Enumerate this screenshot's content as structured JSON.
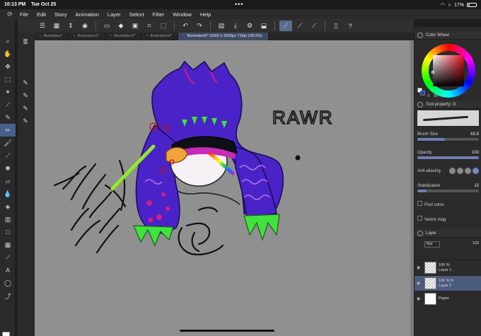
{
  "status_bar": {
    "time": "10:13 PM",
    "date": "Tue Oct 25",
    "battery": "17%"
  },
  "menu": [
    "File",
    "Edit",
    "Story",
    "Animation",
    "Layer",
    "Select",
    "Filter",
    "Window",
    "Help"
  ],
  "doc_tabs": [
    {
      "label": "Illustration*"
    },
    {
      "label": "Illustration2*"
    },
    {
      "label": "Illustration3*"
    },
    {
      "label": "Illustration4*"
    },
    {
      "label": "Illustration5* (3000 x 3200px 72dpi 106.5%)",
      "active": true
    }
  ],
  "canvas": {
    "text": "RAWR"
  },
  "color_wheel": {
    "title": "Color Wheel",
    "h": "0",
    "s": "90",
    "v": "13"
  },
  "tool_property": {
    "title": "Tool property: G",
    "brush_size_label": "Brush Size",
    "brush_size": "63.8",
    "opacity_label": "Opacity",
    "opacity": "100",
    "anti_aliasing_label": "Anti-aliasing",
    "stabilization_label": "Stabilization",
    "stabilization": "15",
    "post_correction_label": "Post corre",
    "vector_magnet_label": "Vector mag"
  },
  "layer_panel": {
    "title": "Layer",
    "blend_mode": "Nor",
    "opacity": "100",
    "layers": [
      {
        "name": "Layer 1",
        "info": "100 %"
      },
      {
        "name": "Layer 2",
        "info": "100 % N",
        "selected": true
      },
      {
        "name": "Paper",
        "info": ""
      }
    ]
  },
  "colors": {
    "active_tool": "#45608a",
    "canvas_bg": "#909090",
    "hat_purple": "#4a23c8",
    "tentacle_green": "#41e23d",
    "spots_magenta": "#d31c8a"
  }
}
